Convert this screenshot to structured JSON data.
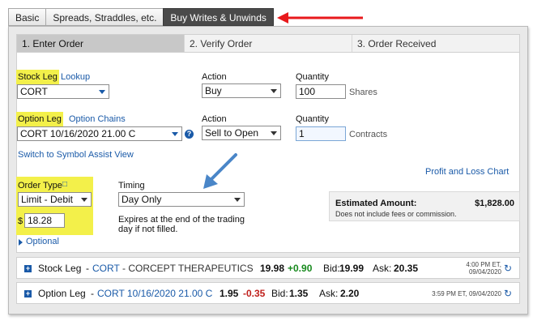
{
  "tabs": [
    "Basic",
    "Spreads, Straddles, etc.",
    "Buy Writes & Unwinds"
  ],
  "steps": [
    "1. Enter Order",
    "2. Verify Order",
    "3. Order Received"
  ],
  "stock_leg": {
    "label": "Stock Leg",
    "lookup": "Lookup",
    "symbol": "CORT",
    "action_label": "Action",
    "action": "Buy",
    "quantity_label": "Quantity",
    "quantity": "100",
    "unit": "Shares"
  },
  "option_leg": {
    "label": "Option Leg",
    "chains": "Option Chains",
    "symbol": "CORT 10/16/2020 21.00 C",
    "help": "?",
    "action_label": "Action",
    "action": "Sell to Open",
    "quantity_label": "Quantity",
    "quantity": "1",
    "unit": "Contracts"
  },
  "switch_link": "Switch to Symbol Assist View",
  "profit_loss_link": "Profit and Loss Chart",
  "order_type": {
    "label": "Order Type",
    "value": "Limit - Debit",
    "currency": "$",
    "price": "18.28",
    "optional": "Optional"
  },
  "timing": {
    "label": "Timing",
    "value": "Day Only",
    "note_line1": "Expires at the end of the trading",
    "note_line2": "day if not filled."
  },
  "estimate": {
    "label": "Estimated Amount:",
    "amount": "$1,828.00",
    "note": "Does not include fees or commission."
  },
  "quotes": [
    {
      "leg": "Stock Leg",
      "sep": " - ",
      "symbol": "CORT",
      "name": " - CORCEPT THERAPEUTICS",
      "last": "19.98",
      "change": "+0.90",
      "bid_label": "Bid:",
      "bid": "19.99",
      "ask_label": "Ask:",
      "ask": "20.35",
      "time_line1": "4:00 PM ET,",
      "time_line2": "09/04/2020"
    },
    {
      "leg": "Option Leg",
      "sep": " - ",
      "symbol": "CORT 10/16/2020 21.00 C",
      "name": "",
      "last": "1.95",
      "change": "-0.35",
      "bid_label": "Bid:",
      "bid": "1.35",
      "ask_label": "Ask:",
      "ask": "2.20",
      "time_line1": "3:59 PM ET, 09/04/2020",
      "time_line2": ""
    }
  ],
  "colors": {
    "accent": "#1a5aa8",
    "highlight": "#f3f04a",
    "annotation_arrow": "#e8191c",
    "annotation_arrow_blue": "#4a86c8",
    "up": "#188a1e",
    "down": "#c0201c"
  },
  "icons": {
    "refresh": "refresh-icon",
    "expand": "expand-icon",
    "help": "help-icon",
    "optional": "triangle-right-icon"
  }
}
